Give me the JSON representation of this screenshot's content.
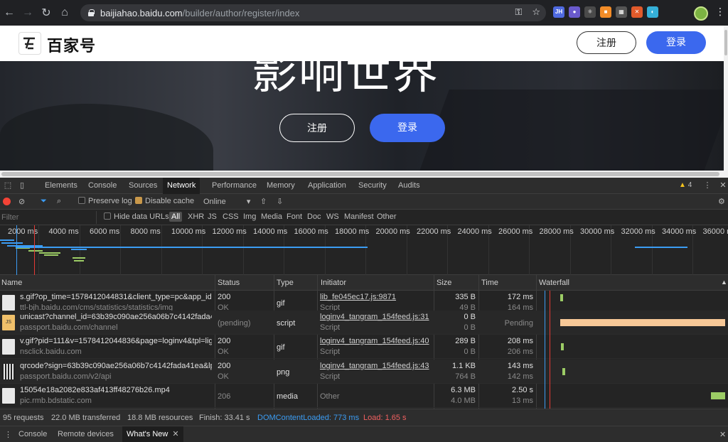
{
  "browser": {
    "url_host": "baijiahao.baidu.com",
    "url_path": "/builder/author/register/index",
    "extensions": [
      {
        "label": "JH",
        "color": "#4f6ae0"
      },
      {
        "label": "●",
        "color": "#6a5acd"
      },
      {
        "label": "⚛",
        "color": "#4a4a4a"
      },
      {
        "label": "■",
        "color": "#f28c28"
      },
      {
        "label": "▦",
        "color": "#555555"
      },
      {
        "label": "✕",
        "color": "#e05a2b"
      },
      {
        "label": "◐",
        "color": "#35b0d8"
      }
    ]
  },
  "site": {
    "logo_text": "百家号",
    "register": "注册",
    "login": "登录",
    "hero_title": "影响世界",
    "hero_register": "注册",
    "hero_login": "登录"
  },
  "devtools": {
    "tabs": [
      "Elements",
      "Console",
      "Sources",
      "Network",
      "Performance",
      "Memory",
      "Application",
      "Security",
      "Audits"
    ],
    "active_tab": "Network",
    "warning_count": "4",
    "preserve_log": "Preserve log",
    "disable_cache": "Disable cache",
    "throttle": "Online",
    "filter_placeholder": "Filter",
    "hide_data_urls": "Hide data URLs",
    "filter_types": [
      "All",
      "XHR",
      "JS",
      "CSS",
      "Img",
      "Media",
      "Font",
      "Doc",
      "WS",
      "Manifest",
      "Other"
    ],
    "timeline_ticks": [
      "2000 ms",
      "4000 ms",
      "6000 ms",
      "8000 ms",
      "10000 ms",
      "12000 ms",
      "14000 ms",
      "16000 ms",
      "18000 ms",
      "20000 ms",
      "22000 ms",
      "24000 ms",
      "26000 ms",
      "28000 ms",
      "30000 ms",
      "32000 ms",
      "34000 ms",
      "36000 ms"
    ],
    "columns": {
      "name": "Name",
      "status": "Status",
      "type": "Type",
      "initiator": "Initiator",
      "size": "Size",
      "time": "Time",
      "waterfall": "Waterfall"
    },
    "rows": [
      {
        "name": "s.gif?op_time=1578412044831&client_type=pc&app_id=...",
        "host": "ttl-bjh.baidu.com/cms/statistics/statistics/img",
        "status": "200",
        "status_text": "OK",
        "type": "gif",
        "initiator": "lib_fe045ec17.js:9871",
        "initiator_sub": "Script",
        "size": "335 B",
        "size_sub": "49 B",
        "time": "172 ms",
        "time_sub": "164 ms",
        "icon": "img"
      },
      {
        "name": "unicast?channel_id=63b39c090ae256a06b7c4142fada41...",
        "host": "passport.baidu.com/channel",
        "status": "(pending)",
        "status_text": "",
        "type": "script",
        "initiator": "loginv4_tangram_154feed.js:31",
        "initiator_sub": "Script",
        "size": "0 B",
        "size_sub": "0 B",
        "time": "Pending",
        "time_sub": "",
        "icon": "JS"
      },
      {
        "name": "v.gif?pid=111&v=1578412044836&page=loginv4&tpl=lig...",
        "host": "nsclick.baidu.com",
        "status": "200",
        "status_text": "OK",
        "type": "gif",
        "initiator": "loginv4_tangram_154feed.js:40",
        "initiator_sub": "Script",
        "size": "289 B",
        "size_sub": "0 B",
        "time": "208 ms",
        "time_sub": "206 ms",
        "icon": "img"
      },
      {
        "name": "qrcode?sign=63b39c090ae256a06b7c4142fada41ea&lp=...",
        "host": "passport.baidu.com/v2/api",
        "status": "200",
        "status_text": "OK",
        "type": "png",
        "initiator": "loginv4_tangram_154feed.js:43",
        "initiator_sub": "Script",
        "size": "1.1 KB",
        "size_sub": "764 B",
        "time": "143 ms",
        "time_sub": "142 ms",
        "icon": "qr"
      },
      {
        "name": "15054e18a2082e833af413ff48276b26.mp4",
        "host": "pic.rmb.bdstatic.com",
        "status": "206",
        "status_text": "",
        "type": "media",
        "initiator": "Other",
        "initiator_sub": "",
        "size": "6.3 MB",
        "size_sub": "4.0 MB",
        "time": "2.50 s",
        "time_sub": "13 ms",
        "icon": "doc"
      }
    ],
    "summary": {
      "requests": "95 requests",
      "transferred": "22.0 MB transferred",
      "resources": "18.8 MB resources",
      "finish": "Finish: 33.41 s",
      "dom": "DOMContentLoaded: 773 ms",
      "load": "Load: 1.65 s"
    },
    "drawer_tabs": [
      "Console",
      "Remote devices",
      "What's New"
    ],
    "drawer_active": "What's New"
  },
  "colors": {
    "accent": "#3b68ee",
    "pending_bar": "#f7c897",
    "received_bar": "#9ccc65",
    "dom_line": "#3b9cf3",
    "load_line": "#e53935"
  }
}
